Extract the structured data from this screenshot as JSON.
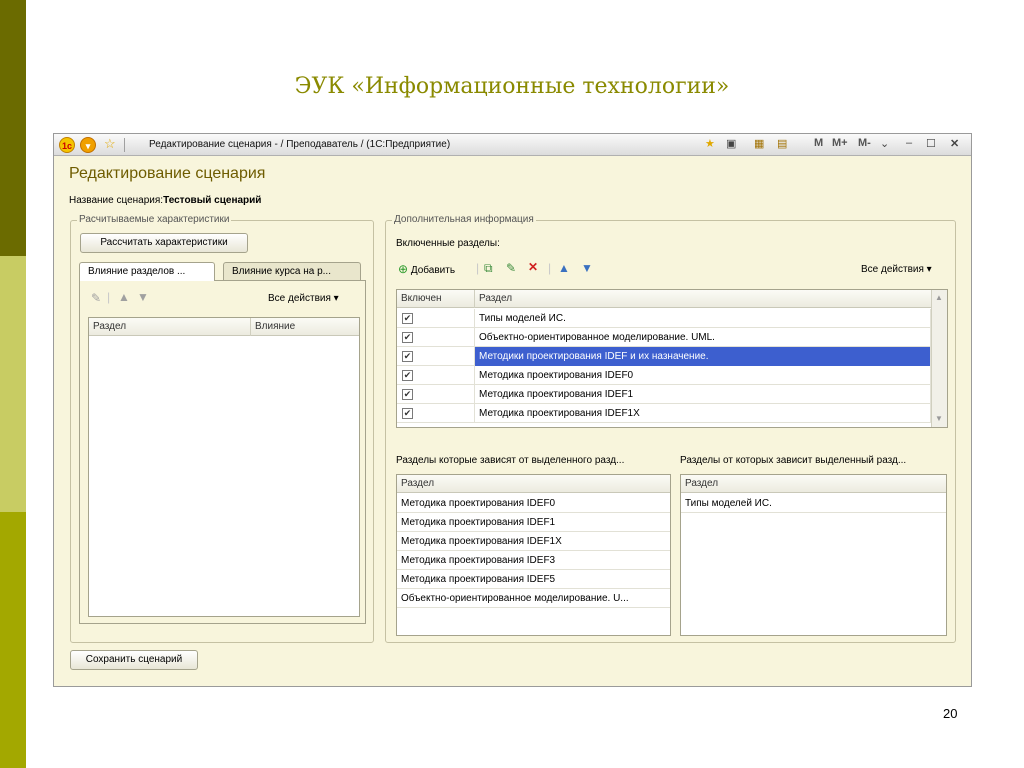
{
  "slide": {
    "title": "ЭУК «Информационные технологии»",
    "page_number": "20"
  },
  "window": {
    "title": "Редактирование сценария - / Преподаватель / (1С:Предприятие)",
    "controls": [
      "M",
      "M+",
      "M-"
    ]
  },
  "form": {
    "title": "Редактирование сценария",
    "name_label": "Название сценария:",
    "name_value": "Тестовый сценарий",
    "save_button": "Сохранить сценарий"
  },
  "left_group": {
    "label": "Расчитываемые характеристики",
    "calc_button": "Рассчитать характеристики",
    "tabs": [
      "Влияние разделов ...",
      "Влияние курса на р..."
    ],
    "all_actions": "Все действия",
    "columns": [
      "Раздел",
      "Влияние"
    ]
  },
  "right_group": {
    "label": "Дополнительная информация",
    "included_label": "Включенные разделы:",
    "add_button": "Добавить",
    "all_actions": "Все действия",
    "columns": [
      "Включен",
      "Раздел"
    ],
    "rows": [
      {
        "checked": true,
        "name": "Типы моделей ИС."
      },
      {
        "checked": true,
        "name": "Объектно-ориентированное моделирование. UML."
      },
      {
        "checked": true,
        "name": "Методики проектирования IDEF и их назначение."
      },
      {
        "checked": true,
        "name": "Методика проектирования IDEF0"
      },
      {
        "checked": true,
        "name": "Методика проектирования IDEF1"
      },
      {
        "checked": true,
        "name": "Методика проектирования IDEF1X"
      }
    ],
    "dependent_label": "Разделы которые зависят от выделенного разд...",
    "dependent_column": "Раздел",
    "dependent_rows": [
      "Методика проектирования IDEF0",
      "Методика проектирования IDEF1",
      "Методика проектирования IDEF1X",
      "Методика проектирования IDEF3",
      "Методика проектирования IDEF5",
      "Объектно-ориентированное моделирование. U..."
    ],
    "depends_on_label": "Разделы от которых зависит выделенный разд...",
    "depends_on_column": "Раздел",
    "depends_on_rows": [
      "Типы моделей ИС."
    ]
  },
  "icons": {
    "checkmark": "✔",
    "dropdown": "▾"
  }
}
